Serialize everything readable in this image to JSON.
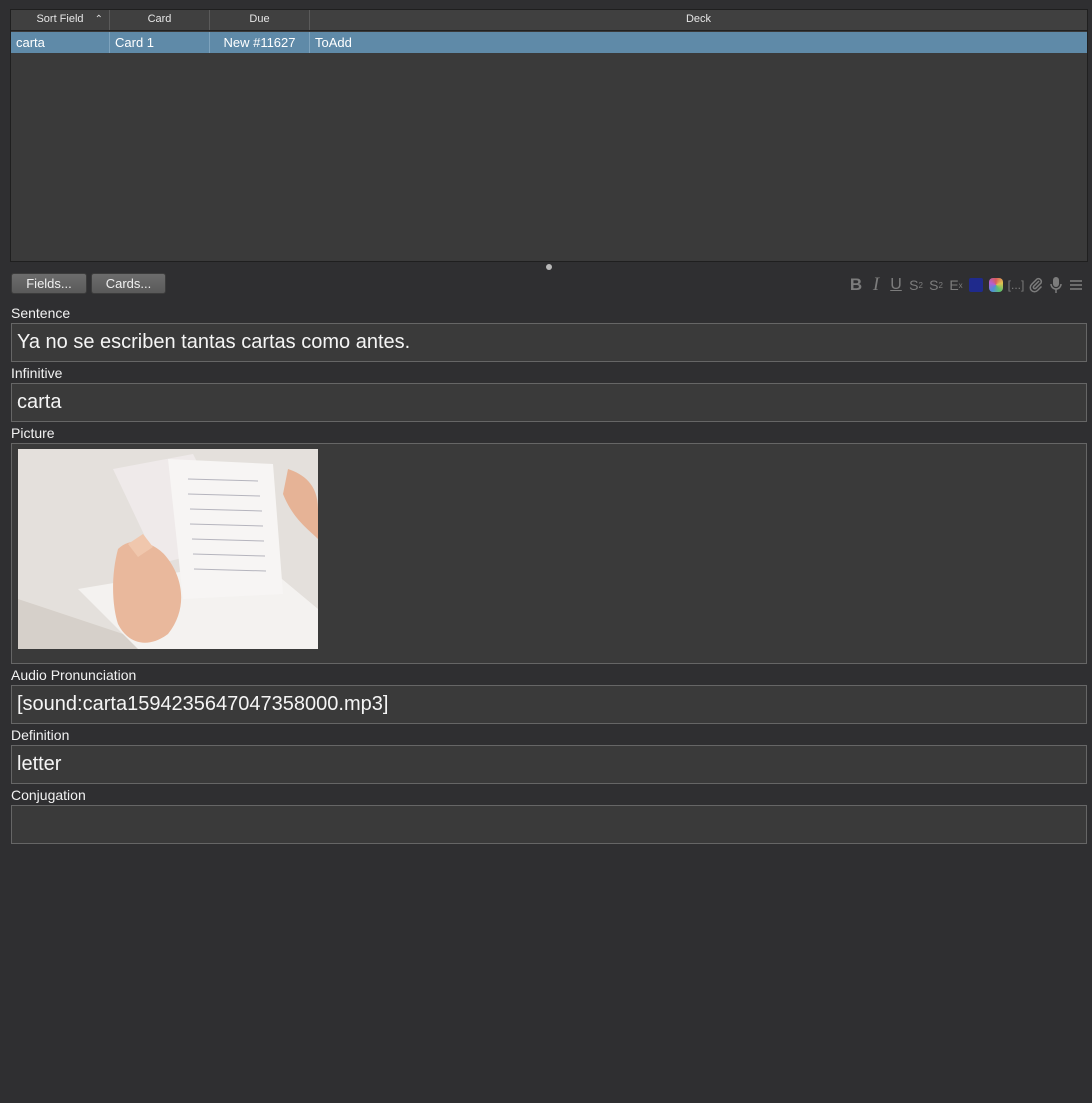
{
  "table": {
    "columns": [
      "Sort Field",
      "Card",
      "Due",
      "Deck"
    ],
    "rows": [
      {
        "sort_field": "carta",
        "card": "Card 1",
        "due": "New #11627",
        "deck": "ToAdd"
      }
    ]
  },
  "toolbar": {
    "fields_button": "Fields...",
    "cards_button": "Cards...",
    "format_icons": [
      "bold-icon",
      "italic-icon",
      "underline-icon",
      "superscript-icon",
      "subscript-icon",
      "clear-format-icon",
      "text-color-icon",
      "highlight-color-icon",
      "cloze-icon",
      "attach-icon",
      "record-icon",
      "more-icon"
    ],
    "text_color": "#1f2a8c",
    "cloze_label": "[...]"
  },
  "fields": [
    {
      "label": "Sentence",
      "value": "Ya no se escriben tantas cartas como antes."
    },
    {
      "label": "Infinitive",
      "value": "carta"
    },
    {
      "label": "Picture",
      "value": ""
    },
    {
      "label": "Audio Pronunciation",
      "value": "[sound:carta1594235647047358000.mp3]"
    },
    {
      "label": "Definition",
      "value": "letter"
    },
    {
      "label": "Conjugation",
      "value": ""
    }
  ]
}
